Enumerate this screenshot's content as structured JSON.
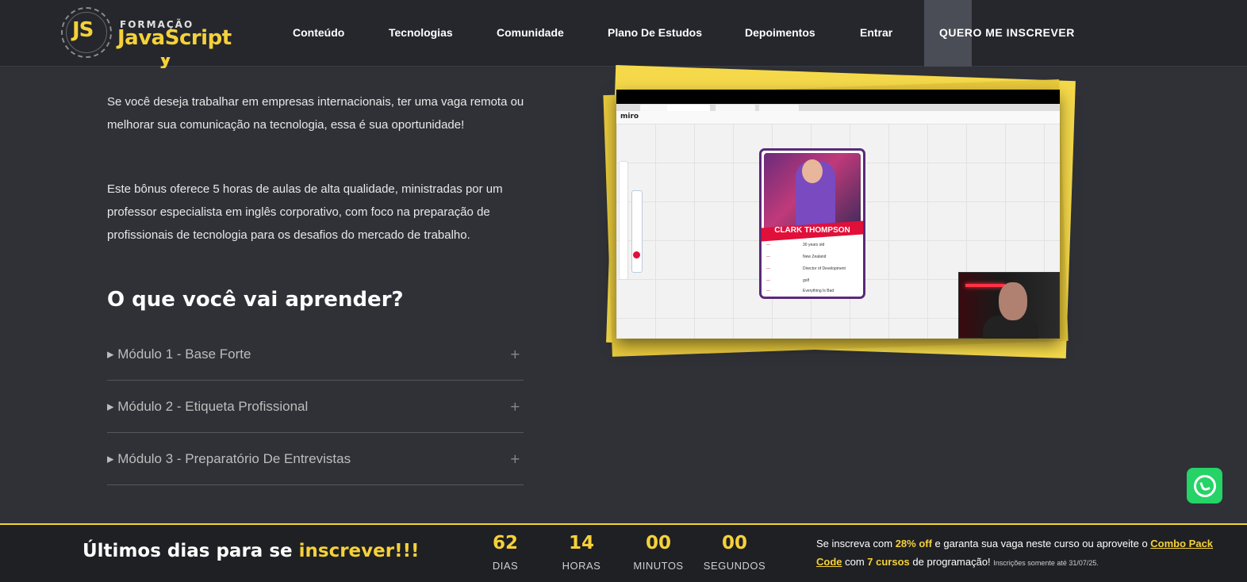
{
  "header": {
    "logo": {
      "mark": "JS",
      "line1": "FORMAÇÃO",
      "line2": "JavaScript"
    },
    "nav": [
      {
        "label": "Conteúdo"
      },
      {
        "label": "Tecnologias"
      },
      {
        "label": "Comunidade"
      },
      {
        "label": "Plano De Estudos"
      },
      {
        "label": "Depoimentos"
      },
      {
        "label": "Entrar"
      }
    ],
    "cta": "QUERO ME INSCREVER"
  },
  "main": {
    "paragraphs": [
      "Se você deseja trabalhar em empresas internacionais, ter uma vaga remota ou melhorar sua comunicação na tecnologia, essa é sua oportunidade!",
      "Este bônus oferece 5 horas de aulas de alta qualidade, ministradas por um professor especialista em inglês corporativo, com foco na preparação de profissionais de tecnologia para os desafios do mercado de trabalho."
    ],
    "learn_title": "O que você vai aprender?",
    "modules": [
      {
        "label": "▸ Módulo 1 - Base Forte",
        "icon": "plus-icon"
      },
      {
        "label": "▸ Módulo 2 - Etiqueta Profissional",
        "icon": "plus-icon"
      },
      {
        "label": "▸ Módulo 3 - Preparatório De Entrevistas",
        "icon": "plus-icon"
      }
    ]
  },
  "video": {
    "app_logo": "miro",
    "card_name": "CLARK THOMPSON",
    "card_rows": [
      {
        "value": "30 years old"
      },
      {
        "value": "New Zealand"
      },
      {
        "value": "Director of Development"
      },
      {
        "value": "golf"
      },
      {
        "value": "Everything Is Bad"
      }
    ]
  },
  "countdown_bar": {
    "title_prefix": "Últimos dias para se ",
    "title_highlight": "inscrever!!!",
    "units": [
      {
        "value": "62",
        "label": "DIAS"
      },
      {
        "value": "14",
        "label": "HORAS"
      },
      {
        "value": "00",
        "label": "MINUTOS"
      },
      {
        "value": "00",
        "label": "SEGUNDOS"
      }
    ],
    "offer": {
      "t1": "Se inscreva com ",
      "discount": "28% off",
      "t2": " e garanta sua vaga neste curso ou aproveite o ",
      "link": "Combo Pack Code",
      "t3": " com ",
      "courses": "7 cursos",
      "t4": " de programação! ",
      "small": "Inscrições somente até 31/07/25."
    }
  },
  "colors": {
    "accent": "#f5d13a",
    "background": "#2f3137",
    "header_bg": "#25272c",
    "whatsapp": "#25d366"
  },
  "whatsapp": {
    "icon": "whatsapp-icon"
  }
}
